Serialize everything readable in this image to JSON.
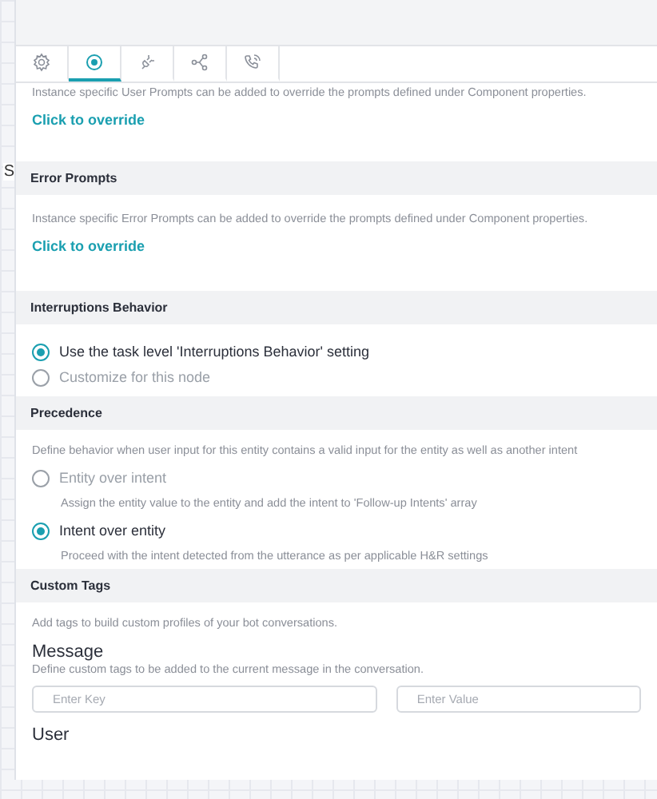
{
  "background_fragment": "S",
  "tabs": [
    {
      "kind": "gear",
      "selected": false
    },
    {
      "kind": "target",
      "selected": true
    },
    {
      "kind": "plug",
      "selected": false
    },
    {
      "kind": "share",
      "selected": false
    },
    {
      "kind": "phone",
      "selected": false
    }
  ],
  "sections": [
    {
      "kind": "prompt",
      "description": "Instance specific User Prompts can be added to override the prompts defined under Component properties.",
      "link": "Click to override"
    },
    {
      "kind": "prompt",
      "title": "Error Prompts",
      "description": "Instance specific Error Prompts can be added to override the prompts defined under Component properties.",
      "link": "Click to override"
    },
    {
      "kind": "radios",
      "title": "Interruptions Behavior",
      "options": [
        {
          "label": "Use the task level 'Interruptions Behavior' setting",
          "selected": true
        },
        {
          "label": "Customize for this node",
          "selected": false
        }
      ]
    },
    {
      "kind": "radios",
      "title": "Precedence",
      "description": "Define behavior when user input for this entity contains a valid input for the entity as well as another intent",
      "options": [
        {
          "label": "Entity over intent",
          "hint": "Assign the entity value to the entity and add the intent to 'Follow-up Intents' array",
          "selected": false
        },
        {
          "label": "Intent over entity",
          "hint": "Proceed with the intent detected from the utterance as per applicable H&R settings",
          "selected": true
        }
      ]
    },
    {
      "kind": "tags",
      "title": "Custom Tags",
      "description": "Add tags to build custom profiles of your bot conversations.",
      "groups": [
        {
          "heading": "Message",
          "description": "Define custom tags to be added to the current message in the conversation.",
          "key_placeholder": "Enter Key",
          "value_placeholder": "Enter Value"
        },
        {
          "heading": "User"
        }
      ]
    }
  ]
}
